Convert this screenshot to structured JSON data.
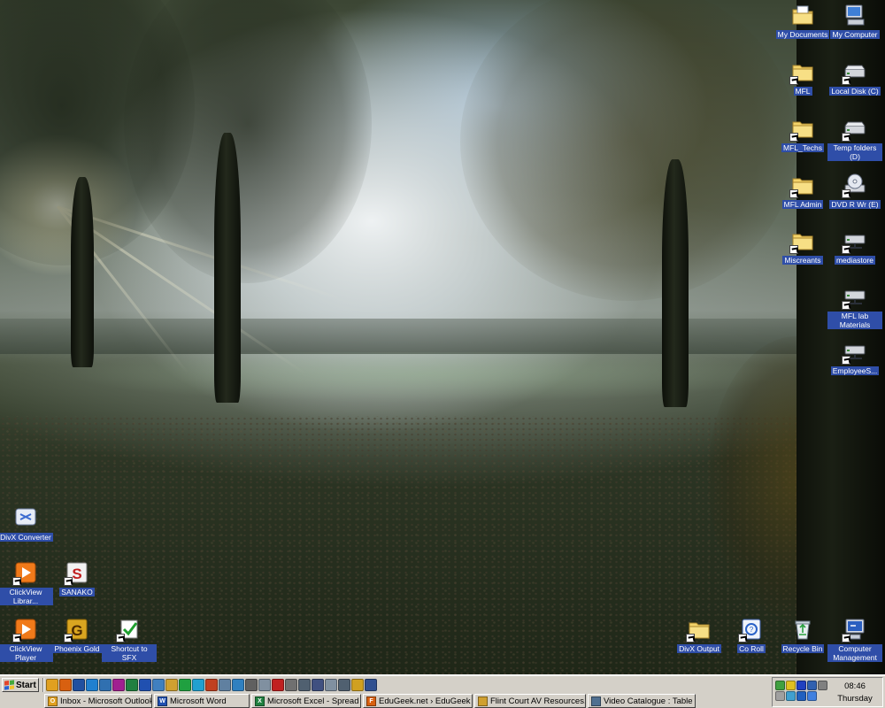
{
  "desktop_icons": {
    "my_documents": "My Documents",
    "my_computer": "My Computer",
    "mfl": "MFL",
    "local_disk": "Local Disk (C)",
    "mfl_techs": "MFL_Techs",
    "temp_folders": "Temp folders (D)",
    "mfl_admin": "MFL Admin",
    "dvd": "DVD R Wr (E)",
    "miscreants": "Miscreants",
    "mediastore": "mediastore",
    "mfl_lab": "MFL lab Materials",
    "employee": "EmployeeS...",
    "divx_converter": "DivX Converter",
    "clickview_library": "ClickView Librar...",
    "sanako": "SANAKO",
    "clickview_player": "ClickView Player",
    "phoenix_gold": "Phoenix Gold",
    "shortcut_sfx": "Shortcut to SFX",
    "divx_output": "DivX Output",
    "co_roll": "Co Roll",
    "recycle_bin": "Recycle Bin",
    "computer_management": "Computer Management"
  },
  "taskbar": {
    "start_label": "Start",
    "quick_launch": [
      {
        "icon": "outlook-icon",
        "color": "#e0a020"
      },
      {
        "icon": "firefox-icon",
        "color": "#d86010"
      },
      {
        "icon": "desktop-icon",
        "color": "#2050a0"
      },
      {
        "icon": "ie-icon",
        "color": "#2080d0"
      },
      {
        "icon": "media-player-icon",
        "color": "#3070b0"
      },
      {
        "icon": "onenote-icon",
        "color": "#a02090"
      },
      {
        "icon": "excel-icon",
        "color": "#208040"
      },
      {
        "icon": "word-icon",
        "color": "#2050b0"
      },
      {
        "icon": "help-icon",
        "color": "#4080c0"
      },
      {
        "icon": "folder-icon",
        "color": "#d0a030"
      },
      {
        "icon": "check-icon",
        "color": "#20a040"
      },
      {
        "icon": "skype-icon",
        "color": "#20a0d0"
      },
      {
        "icon": "game-icon",
        "color": "#c04020"
      },
      {
        "icon": "capture-icon",
        "color": "#6080a0"
      },
      {
        "icon": "globe-icon",
        "color": "#3080c0"
      },
      {
        "icon": "mouse-icon",
        "color": "#606060"
      },
      {
        "icon": "document-icon",
        "color": "#8090a0"
      },
      {
        "icon": "pdf-icon",
        "color": "#c02020"
      },
      {
        "icon": "calculator-icon",
        "color": "#707070"
      },
      {
        "icon": "window-icon",
        "color": "#506070"
      },
      {
        "icon": "display-icon",
        "color": "#405080"
      },
      {
        "icon": "cd-icon",
        "color": "#8090a0"
      },
      {
        "icon": "window-icon-2",
        "color": "#506070"
      },
      {
        "icon": "media-icon",
        "color": "#d0a020"
      },
      {
        "icon": "clock-icon",
        "color": "#305090"
      }
    ],
    "tasks": [
      {
        "label": "Inbox - Microsoft Outlook",
        "icon": "outlook-icon",
        "color": "#e0a020",
        "glyph": "O"
      },
      {
        "label": "Microsoft Word",
        "icon": "word-icon",
        "color": "#2050b0",
        "glyph": "W"
      },
      {
        "label": "Microsoft Excel - Spread ...",
        "icon": "excel-icon",
        "color": "#208040",
        "glyph": "X"
      },
      {
        "label": "EduGeek.net › EduGeek ...",
        "icon": "firefox-icon",
        "color": "#d86010",
        "glyph": "F"
      },
      {
        "label": "Flint Court AV Resources...",
        "icon": "folder-icon",
        "color": "#d0a030",
        "glyph": ""
      },
      {
        "label": "Video Catalogue : Table",
        "icon": "table-icon",
        "color": "#507090",
        "glyph": ""
      }
    ],
    "tray_icons": [
      {
        "icon": "network-icon",
        "color": "#40a040"
      },
      {
        "icon": "sound-icon",
        "color": "#e0c020"
      },
      {
        "icon": "media-icon",
        "color": "#2040c0"
      },
      {
        "icon": "display-icon",
        "color": "#3060b0"
      },
      {
        "icon": "security-icon",
        "color": "#808080"
      },
      {
        "icon": "antivirus-icon",
        "color": "#a0a0a0"
      },
      {
        "icon": "power-icon",
        "color": "#40a0d0"
      },
      {
        "icon": "bluetooth-icon",
        "color": "#2060c0"
      },
      {
        "icon": "update-icon",
        "color": "#4080e0"
      }
    ],
    "clock_time": "08:46",
    "clock_day": "Thursday"
  }
}
